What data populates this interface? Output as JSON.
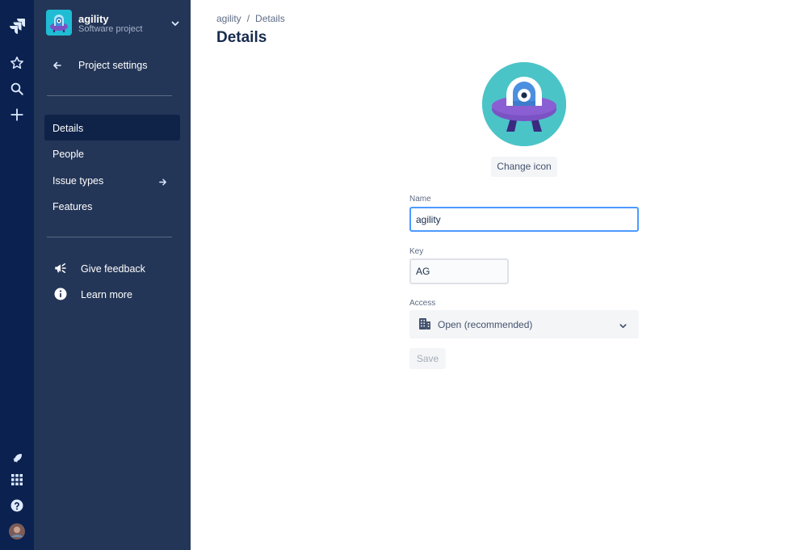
{
  "global_nav": {
    "icons": [
      "jira-logo-icon",
      "star-icon",
      "search-icon",
      "plus-icon",
      "rocket-icon",
      "app-switcher-icon",
      "help-icon",
      "user-avatar"
    ]
  },
  "sidebar": {
    "project_name": "agility",
    "project_type": "Software project",
    "back_label": "Project settings",
    "items": [
      {
        "label": "Details",
        "active": true
      },
      {
        "label": "People",
        "active": false
      },
      {
        "label": "Issue types",
        "active": false
      },
      {
        "label": "Features",
        "active": false
      }
    ],
    "utility": [
      {
        "label": "Give feedback",
        "icon": "megaphone-icon"
      },
      {
        "label": "Learn more",
        "icon": "info-icon"
      }
    ]
  },
  "breadcrumb": {
    "project": "agility",
    "separator": "/",
    "current": "Details"
  },
  "page": {
    "title": "Details",
    "change_icon_label": "Change icon"
  },
  "form": {
    "name_label": "Name",
    "name_value": "agility",
    "key_label": "Key",
    "key_value": "AG",
    "access_label": "Access",
    "access_value": "Open (recommended)",
    "save_label": "Save"
  },
  "colors": {
    "global_nav_bg": "#0b2150",
    "sidebar_bg": "#243657",
    "active_item_bg": "#0f2248",
    "focus_border": "#4c9aff",
    "avatar_bg": "#4bc4c7"
  }
}
